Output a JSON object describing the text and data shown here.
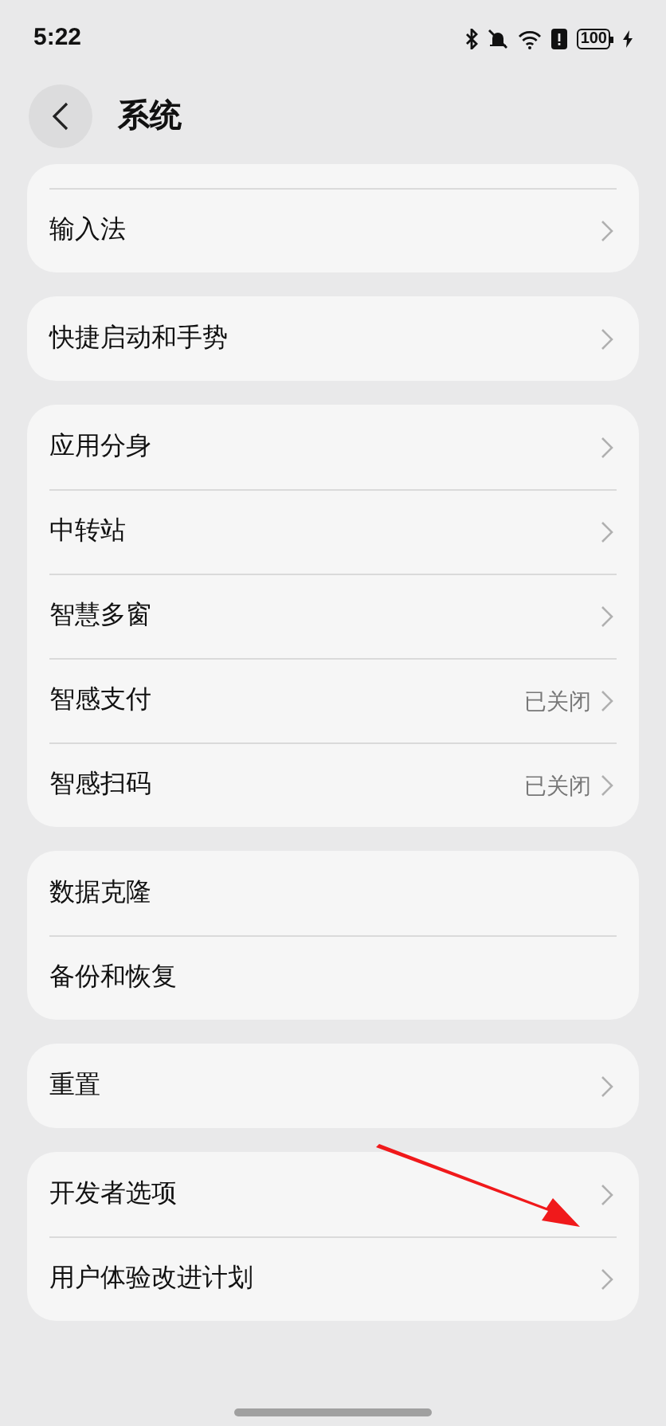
{
  "status_bar": {
    "time": "5:22",
    "battery": "100"
  },
  "header": {
    "title": "系统"
  },
  "groups": [
    {
      "cut_top": true,
      "items": [
        {
          "label": "输入法",
          "chevron": true
        }
      ]
    },
    {
      "cut_top": false,
      "items": [
        {
          "label": "快捷启动和手势",
          "chevron": true
        }
      ]
    },
    {
      "cut_top": false,
      "items": [
        {
          "label": "应用分身",
          "chevron": true
        },
        {
          "label": "中转站",
          "chevron": true
        },
        {
          "label": "智慧多窗",
          "chevron": true
        },
        {
          "label": "智感支付",
          "value": "已关闭",
          "chevron": true
        },
        {
          "label": "智感扫码",
          "value": "已关闭",
          "chevron": true
        }
      ]
    },
    {
      "cut_top": false,
      "items": [
        {
          "label": "数据克隆",
          "chevron": false
        },
        {
          "label": "备份和恢复",
          "chevron": false
        }
      ]
    },
    {
      "cut_top": false,
      "items": [
        {
          "label": "重置",
          "chevron": true
        }
      ]
    },
    {
      "cut_top": false,
      "items": [
        {
          "label": "开发者选项",
          "chevron": true
        },
        {
          "label": "用户体验改进计划",
          "chevron": true
        }
      ]
    }
  ]
}
